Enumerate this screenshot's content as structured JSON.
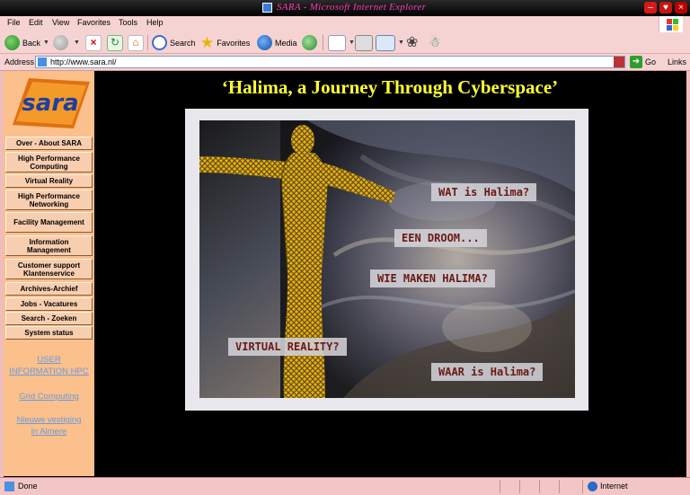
{
  "window": {
    "title": "SARA - Microsoft Internet Explorer",
    "controls": [
      "minimize",
      "maximize",
      "close"
    ]
  },
  "menu": [
    {
      "label": "File"
    },
    {
      "label": "Edit"
    },
    {
      "label": "View"
    },
    {
      "label": "Favorites"
    },
    {
      "label": "Tools"
    },
    {
      "label": "Help"
    }
  ],
  "toolbar": {
    "back_label": "Back",
    "search_label": "Search",
    "favorites_label": "Favorites",
    "media_label": "Media"
  },
  "address": {
    "label": "Address",
    "url": "http://www.sara.nl/",
    "go_label": "Go",
    "links_label": "Links"
  },
  "sidebar": {
    "logo_text": "sara",
    "nav": [
      {
        "label": "Over - About SARA"
      },
      {
        "label": "High Performance Computing"
      },
      {
        "label": "Virtual Reality"
      },
      {
        "label": "High Performance Networking"
      },
      {
        "label": "Facility Management"
      },
      {
        "label": "Information Management"
      },
      {
        "label": "Customer support Klantenservice"
      },
      {
        "label": "Archives-Archief"
      },
      {
        "label": "Jobs - Vacatures"
      },
      {
        "label": "Search - Zoeken"
      },
      {
        "label": "System status"
      }
    ],
    "links": [
      {
        "label": "USER INFORMATION HPC"
      },
      {
        "label": "Grid Computing"
      },
      {
        "label": "Nieuwe vestiging in Almere"
      }
    ]
  },
  "main": {
    "heading": "‘Halima, a Journey Through Cyberspace’",
    "captions": [
      {
        "label": "WAT is Halima?"
      },
      {
        "label": "EEN DROOM..."
      },
      {
        "label": "WIE MAKEN HALIMA?"
      },
      {
        "label": "VIRTUAL REALITY?"
      },
      {
        "label": "WAAR is Halima?"
      }
    ]
  },
  "status": {
    "text": "Done",
    "zone": "Internet"
  },
  "colors": {
    "heading": "#ffff33",
    "sidebar": "#fbc08b",
    "chrome": "#f6d3d3",
    "caption_text": "#6b1a14"
  }
}
